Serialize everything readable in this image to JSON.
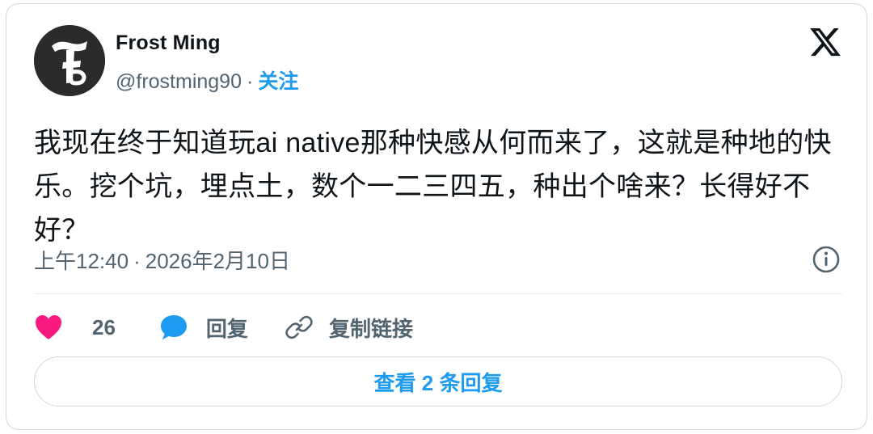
{
  "author": {
    "name": "Frost Ming",
    "handle": "@frostming90",
    "separator": "·",
    "follow_label": "关注"
  },
  "tweet": {
    "text": "我现在终于知道玩ai native那种快感从何而来了，这就是种地的快乐。挖个坑，埋点土，数个一二三四五，种出个啥来？长得好不好？",
    "time": "上午12:40",
    "separator": "·",
    "date": "2026年2月10日"
  },
  "actions": {
    "like_count": "26",
    "reply_label": "回复",
    "copy_link_label": "复制链接"
  },
  "view_replies_label": "查看 2 条回复",
  "icons": {
    "avatar": "avatar-logo",
    "platform": "x-logo-icon",
    "info": "info-icon",
    "like": "heart-icon",
    "reply": "speech-bubble-icon",
    "copy": "link-icon"
  },
  "colors": {
    "accent": "#1d9bf0",
    "like": "#f91880",
    "secondary_text": "#536471",
    "primary_text": "#0f1419",
    "border": "#cfd9de"
  }
}
